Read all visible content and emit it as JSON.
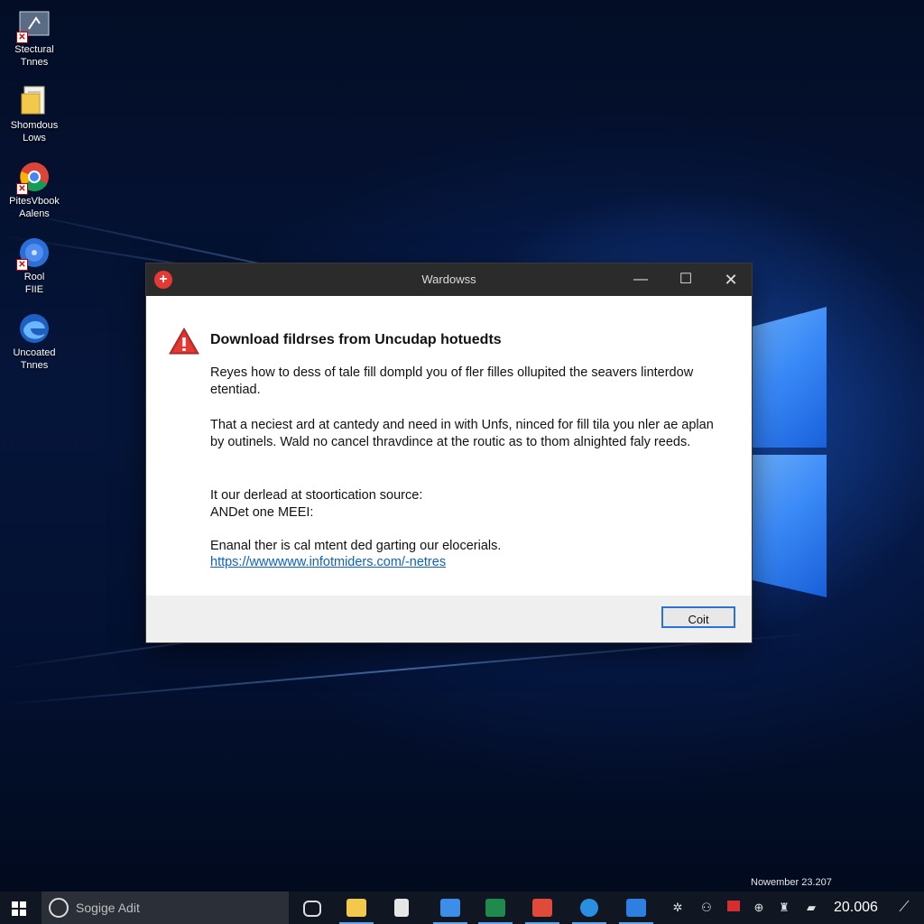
{
  "desktop": {
    "icons": [
      {
        "label": "Stectural\nTnnes",
        "icon": "app-window-icon"
      },
      {
        "label": "Shomdous\nLows",
        "icon": "document-folder-icon"
      },
      {
        "label": "PitesVbook\nAalens",
        "icon": "chrome-browser-icon"
      },
      {
        "label": "Rool\nFIIE",
        "icon": "blue-disc-icon"
      },
      {
        "label": "Uncoated\nTnnes",
        "icon": "edge-browser-icon"
      }
    ]
  },
  "dialog": {
    "title": "Wardowss",
    "heading": "Download fildrses from Uncudap hotuedts",
    "paragraph1": "Reyes how to dess of tale fill dompld you of fler filles ollupited the seavers linterdow etentiad.",
    "paragraph2": "That a neciest ard at cantedy and need in with Unfs, ninced for fill tila you nler ae aplan by outinels. Wald no cancel thravdince at the routic as to thom alnighted faly reeds.",
    "paragraph3_line1": "It our derlead at stoortication source:",
    "paragraph3_line2": "ANDet one MEEI:",
    "paragraph4": "Enanal ther is cal mtent ded garting our elocerials.",
    "link": "https://wwwwww.infotmiders.com/-netres",
    "ok_label": "Coit",
    "minimize_glyph": "—",
    "maximize_glyph": "☐",
    "close_glyph": "✕"
  },
  "taskbar": {
    "search_placeholder": "Sogige Adit",
    "date_text": "Nowember 23.207",
    "clock": "20.006",
    "accent": "#5fa3e8"
  }
}
